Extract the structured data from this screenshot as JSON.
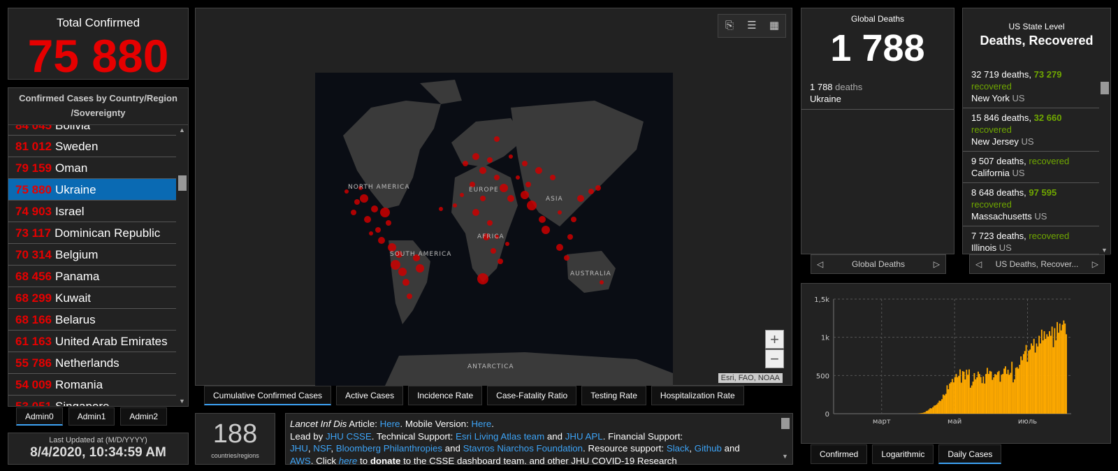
{
  "total_confirmed": {
    "label": "Total Confirmed",
    "value": "75 880"
  },
  "countries": {
    "header": "Confirmed Cases by Country/Region /Sovereignty",
    "items": [
      {
        "count": "81 012",
        "name": "Sweden",
        "selected": false
      },
      {
        "count": "79 159",
        "name": "Oman",
        "selected": false
      },
      {
        "count": "75 880",
        "name": "Ukraine",
        "selected": true
      },
      {
        "count": "74 903",
        "name": "Israel",
        "selected": false
      },
      {
        "count": "73 117",
        "name": "Dominican Republic",
        "selected": false
      },
      {
        "count": "70 314",
        "name": "Belgium",
        "selected": false
      },
      {
        "count": "68 456",
        "name": "Panama",
        "selected": false
      },
      {
        "count": "68 299",
        "name": "Kuwait",
        "selected": false
      },
      {
        "count": "68 166",
        "name": "Belarus",
        "selected": false
      },
      {
        "count": "61 163",
        "name": "United Arab Emirates",
        "selected": false
      },
      {
        "count": "55 786",
        "name": "Netherlands",
        "selected": false
      },
      {
        "count": "54 009",
        "name": "Romania",
        "selected": false
      },
      {
        "count": "53 051",
        "name": "Singapore",
        "selected": false
      }
    ],
    "partial_top": {
      "count": "84 045",
      "name": "Bolivia"
    }
  },
  "admin_tabs": [
    "Admin0",
    "Admin1",
    "Admin2"
  ],
  "last_updated": {
    "label": "Last Updated at (M/D/YYYY)",
    "value": "8/4/2020, 10:34:59 AM"
  },
  "map": {
    "labels": {
      "north_america": "NORTH AMERICA",
      "south_america": "SOUTH AMERICA",
      "europe": "EUROPE",
      "asia": "ASIA",
      "africa": "AFRICA",
      "australia": "AUSTRALIA",
      "antarctica": "ANTARCTICA"
    },
    "attribution": "Esri, FAO, NOAA",
    "zoom_in": "+",
    "zoom_out": "−",
    "tabs": [
      "Cumulative Confirmed Cases",
      "Active Cases",
      "Incidence Rate",
      "Case-Fatality Ratio",
      "Testing Rate",
      "Hospitalization Rate"
    ]
  },
  "countries_count": {
    "value": "188",
    "label": "countries/regions"
  },
  "info": {
    "journal": "Lancet Inf Dis",
    "article": " Article: ",
    "here1": "Here",
    "mobile": ". Mobile Version: ",
    "here2": "Here",
    "led_by": ".",
    "led_by_label": "Lead by ",
    "jhu_csse": "JHU CSSE",
    "tech": ". Technical Support: ",
    "esri": "Esri Living Atlas team",
    "and1": " and ",
    "jhu_apl": "JHU APL",
    "fin": ". Financial Support:",
    "jhu": "JHU",
    "nsf": "NSF",
    "bloomberg": "Bloomberg Philanthropies",
    "and2": " and ",
    "stavros": "Stavros Niarchos Foundation",
    "resource": ". Resource support: ",
    "slack": "Slack",
    "github": "Github",
    "and3": " and",
    "aws": "AWS",
    "click": ". Click ",
    "here3": "here",
    "to": " to ",
    "donate": "donate",
    "tail": " to the CSSE dashboard team, and other JHU COVID-19 Research"
  },
  "global_deaths": {
    "title": "Global Deaths",
    "value": "1 788",
    "entry_count": "1 788",
    "entry_unit": "deaths",
    "entry_country": "Ukraine",
    "pager_label": "Global Deaths"
  },
  "us_state": {
    "title1": "US State Level",
    "title2": "Deaths, Recovered",
    "items": [
      {
        "deaths": "32 719 deaths,",
        "recovered_num": "73 279",
        "recovered": "recovered",
        "state": "New York",
        "country": "US"
      },
      {
        "deaths": "15 846 deaths,",
        "recovered_num": "32 660",
        "recovered": "recovered",
        "state": "New Jersey",
        "country": "US"
      },
      {
        "deaths": "9 507 deaths,",
        "recovered_num": "",
        "recovered": "recovered",
        "state": "California",
        "country": "US"
      },
      {
        "deaths": "8 648 deaths,",
        "recovered_num": "97 595",
        "recovered": "recovered",
        "state": "Massachusetts",
        "country": "US"
      },
      {
        "deaths": "7 723 deaths,",
        "recovered_num": "",
        "recovered": "recovered",
        "state": "Illinois",
        "country": "US"
      }
    ],
    "pager_label": "US Deaths, Recover..."
  },
  "chart_tabs": [
    "Confirmed",
    "Logarithmic",
    "Daily Cases"
  ],
  "colors": {
    "accent_red": "#e60000",
    "recovered_green": "#70a800",
    "link_blue": "#3da3f5",
    "bar_orange": "#ffaa00",
    "selected_blue": "#0a6ab3"
  },
  "chart_data": {
    "type": "bar",
    "title": "",
    "xlabel": "",
    "ylabel": "",
    "y_ticks": [
      "0",
      "500",
      "1k",
      "1,5k"
    ],
    "x_ticks": [
      "март",
      "май",
      "июль"
    ],
    "ylim": [
      0,
      1500
    ],
    "x_range": [
      "2020-01-22",
      "2020-08-03"
    ],
    "x_tick_dates": [
      "2020-03-01",
      "2020-05-01",
      "2020-07-01"
    ],
    "series": [
      {
        "values": [
          0,
          0,
          0,
          0,
          0,
          0,
          0,
          0,
          0,
          0,
          0,
          0,
          0,
          0,
          0,
          0,
          0,
          0,
          0,
          0,
          0,
          0,
          0,
          0,
          0,
          0,
          0,
          0,
          0,
          0,
          0,
          0,
          0,
          0,
          0,
          0,
          0,
          0,
          0,
          0,
          0,
          0,
          0,
          0,
          0,
          0,
          0,
          0,
          0,
          0,
          0,
          0,
          0,
          0,
          0,
          0,
          0,
          0,
          0,
          0,
          0,
          0,
          0,
          0,
          2,
          5,
          8,
          10,
          15,
          20,
          35,
          40,
          56,
          72,
          70,
          85,
          105,
          110,
          122,
          143,
          170,
          168,
          190,
          251,
          240,
          260,
          372,
          320,
          395,
          412,
          455,
          410,
          478,
          520,
          478,
          496,
          580,
          406,
          558,
          550,
          448,
          576,
          510,
          580,
          340,
          370,
          420,
          531,
          450,
          476,
          551,
          520,
          480,
          400,
          488,
          395,
          520,
          600,
          520,
          560,
          552,
          443,
          476,
          519,
          510,
          545,
          560,
          418,
          510,
          520,
          590,
          620,
          520,
          575,
          510,
          535,
          680,
          410,
          450,
          600,
          610,
          590,
          640,
          750,
          700,
          780,
          820,
          900,
          680,
          825,
          840,
          920,
          890,
          980,
          800,
          920,
          880,
          1020,
          920,
          1100,
          960,
          1080,
          980,
          1040,
          1010,
          1080,
          1020,
          1140,
          870,
          1120,
          960,
          1200,
          1060,
          1180,
          1090,
          1165,
          1220,
          1180,
          1040
        ]
      }
    ]
  }
}
